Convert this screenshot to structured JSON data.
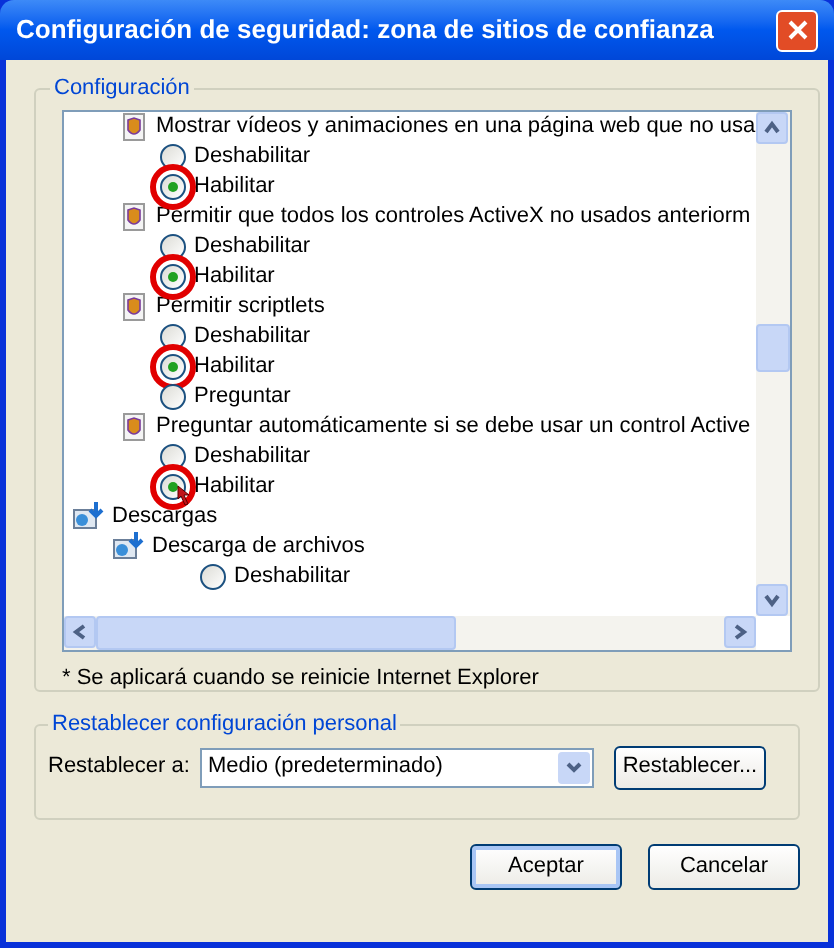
{
  "window": {
    "title": "Configuración de seguridad: zona de sitios de confianza"
  },
  "settings_group": {
    "legend": "Configuración",
    "tree": [
      {
        "kind": "group",
        "children": [
          {
            "kind": "setting",
            "label": "Mostrar vídeos y animaciones en una página web que no usa",
            "children": [
              {
                "kind": "option",
                "label": "Deshabilitar",
                "selected": false,
                "circled": false
              },
              {
                "kind": "option",
                "label": "Habilitar",
                "selected": true,
                "circled": true
              }
            ]
          },
          {
            "kind": "setting",
            "label": "Permitir que todos los controles ActiveX no usados anteriorm",
            "children": [
              {
                "kind": "option",
                "label": "Deshabilitar",
                "selected": false,
                "circled": false
              },
              {
                "kind": "option",
                "label": "Habilitar",
                "selected": true,
                "circled": true
              }
            ]
          },
          {
            "kind": "setting",
            "label": "Permitir scriptlets",
            "children": [
              {
                "kind": "option",
                "label": "Deshabilitar",
                "selected": false,
                "circled": false
              },
              {
                "kind": "option",
                "label": "Habilitar",
                "selected": true,
                "circled": true
              },
              {
                "kind": "option",
                "label": "Preguntar",
                "selected": false,
                "circled": false
              }
            ]
          },
          {
            "kind": "setting",
            "label": "Preguntar automáticamente si se debe usar un control Active",
            "children": [
              {
                "kind": "option",
                "label": "Deshabilitar",
                "selected": false,
                "circled": false
              },
              {
                "kind": "option",
                "label": "Habilitar",
                "selected": true,
                "circled": true,
                "pointer": true
              }
            ]
          }
        ]
      },
      {
        "kind": "category",
        "label": "Descargas",
        "children": [
          {
            "kind": "category",
            "label": "Descarga de archivos",
            "children": [
              {
                "kind": "option",
                "label": "Deshabilitar",
                "selected": false,
                "circled": false
              }
            ]
          }
        ]
      }
    ],
    "footnote": "* Se aplicará cuando se reinicie Internet Explorer"
  },
  "reset_group": {
    "legend": "Restablecer configuración personal",
    "label": "Restablecer a:",
    "value": "Medio (predeterminado)",
    "button": "Restablecer..."
  },
  "buttons": [
    "Aceptar",
    "Cancelar"
  ]
}
